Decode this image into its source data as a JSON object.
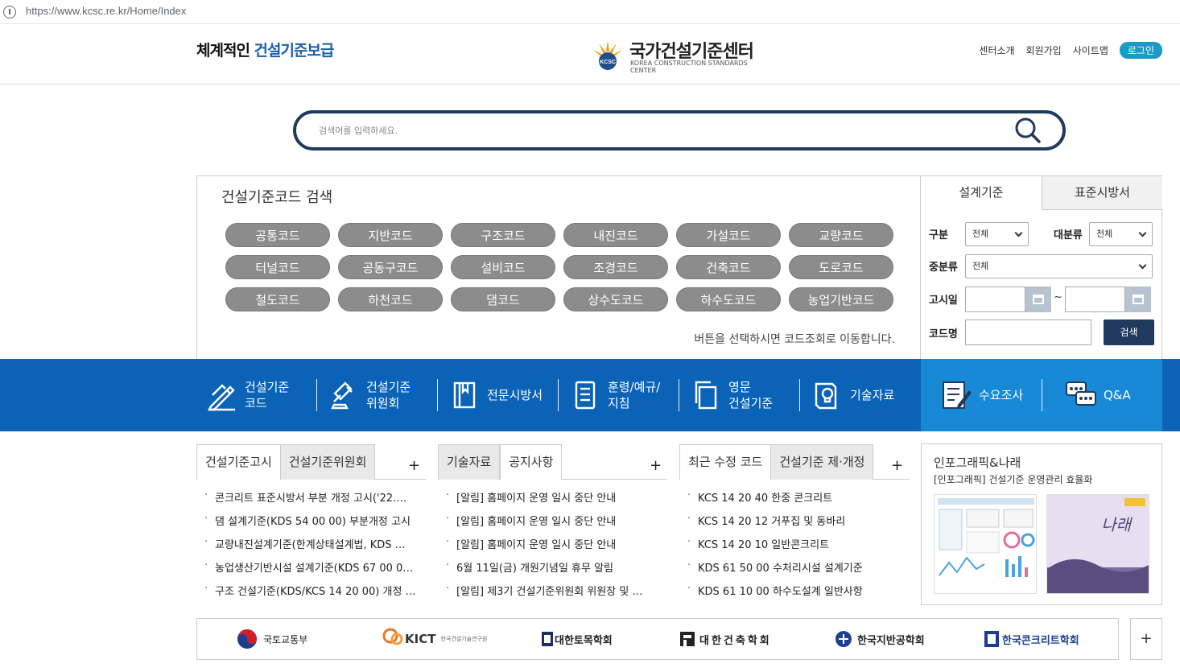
{
  "browser": {
    "url": "https://www.kcsc.re.kr/Home/Index"
  },
  "header": {
    "slogan_a": "체계적인",
    "slogan_b": "건설기준보급",
    "logo_title": "국가건설기준센터",
    "logo_sub": "KOREA CONSTRUCTION STANDARDS CENTER",
    "logo_mark": "KCSC",
    "links": [
      "센터소개",
      "회원가입",
      "사이트맵"
    ],
    "login": "로그인"
  },
  "search": {
    "placeholder": "검색어를 입력하세요."
  },
  "codes": {
    "title": "건설기준코드 검색",
    "buttons": [
      "공통코드",
      "지반코드",
      "구조코드",
      "내진코드",
      "가설코드",
      "교량코드",
      "터널코드",
      "공동구코드",
      "설비코드",
      "조경코드",
      "건축코드",
      "도로코드",
      "철도코드",
      "하천코드",
      "댐코드",
      "상수도코드",
      "하수도코드",
      "농업기반코드"
    ],
    "hint": "버튼을 선택하시면 코드조회로 이동합니다."
  },
  "form": {
    "tabs": [
      "설계기준",
      "표준시방서"
    ],
    "label_gubun": "구분",
    "gubun_value": "전체",
    "label_daebunryu": "대분류",
    "daebunryu_value": "전체",
    "label_jungbunryu": "중분류",
    "jungbunryu_value": "전체",
    "label_date": "고시일",
    "tilde": "~",
    "label_codename": "코드명",
    "search_button": "검색"
  },
  "nav": {
    "items": [
      {
        "label": "건설기준\n코드",
        "icon": "pencil-ruler-icon"
      },
      {
        "label": "건설기준\n위원회",
        "icon": "gavel-icon"
      },
      {
        "label": "전문시방서",
        "icon": "book-icon"
      },
      {
        "label": "훈령/예규/\n지침",
        "icon": "document-list-icon"
      },
      {
        "label": "영문\n건설기준",
        "icon": "copy-pages-icon"
      },
      {
        "label": "기술자료",
        "icon": "lightbulb-doc-icon"
      }
    ],
    "survey": "수요조사",
    "qa": "Q&A"
  },
  "panel1": {
    "tabs": [
      "건설기준고시",
      "건설기준위원회"
    ],
    "items": [
      "콘크리트 표준시방서 부분 개정 고시('22.…",
      "댐 설계기준(KDS 54 00 00) 부분개정 고시",
      "교량내진설계기준(한계상태설계법, KDS …",
      "농업생산기반시설 설계기준(KDS 67 00 0…",
      "구조 건설기준(KDS/KCS 14 20 00) 개정 …"
    ]
  },
  "panel2": {
    "tabs": [
      "기술자료",
      "공지사항"
    ],
    "items": [
      "[알림] 홈페이지 운영 일시 중단 안내",
      "[알림] 홈페이지 운영 일시 중단 안내",
      "[알림] 홈페이지 운영 일시 중단 안내",
      "6월 11일(금) 개원기념일 휴무 알림",
      "[알림] 제3기 건설기준위원회 위원장 및 …"
    ]
  },
  "panel3": {
    "tabs": [
      "최근 수정 코드",
      "건설기준 제·개정"
    ],
    "items": [
      "KCS 14 20 40 한중 콘크리트",
      "KCS 14 20 12 거푸집 및 동바리",
      "KCS 14 20 10 일반콘크리트",
      "KDS 61 50 00 수처리시설 설계기준",
      "KDS 61 10 00 하수도설계 일반사항"
    ]
  },
  "plus": "+",
  "infographic": {
    "title": "인포그래픽&나래",
    "subtitle": "[인포그래픽] 건설기준 운영관리 효율화",
    "magazine": "나래"
  },
  "partners": [
    {
      "name": "국토교통부",
      "icon": "taegeuk-icon"
    },
    {
      "name": "KICT",
      "sub": "한국건설기술연구원",
      "icon": "kict-logo-icon"
    },
    {
      "name": "대한토목학회",
      "icon": "ksce-logo-icon"
    },
    {
      "name": "대한건축학회",
      "icon": "aik-logo-icon"
    },
    {
      "name": "한국지반공학회",
      "icon": "kgs-logo-icon"
    },
    {
      "name": "한국콘크리트학회",
      "icon": "kci-logo-icon"
    }
  ]
}
